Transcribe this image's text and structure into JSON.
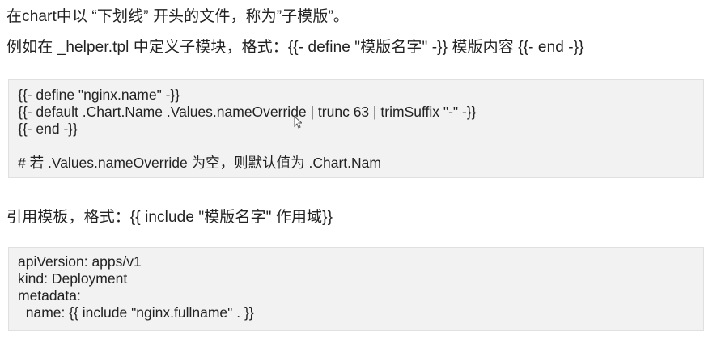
{
  "text": {
    "line1": "在chart中以 “下划线” 开头的文件，称为”子模版”。",
    "line2": "例如在 _helper.tpl 中定义子模块，格式：{{- define \"模版名字\" -}} 模版内容 {{- end -}}",
    "line3": "引用模板，格式：{{ include \"模版名字\" 作用域}}"
  },
  "code_block_1": {
    "lines": [
      "{{- define \"nginx.name\" -}}",
      "{{- default .Chart.Name .Values.nameOverride | trunc 63 | trimSuffix \"-\" -}}",
      "{{- end -}}",
      "",
      "# 若 .Values.nameOverride 为空，则默认值为 .Chart.Nam"
    ]
  },
  "code_block_2": {
    "lines": [
      "apiVersion: apps/v1",
      "kind: Deployment",
      "metadata:",
      "  name: {{ include \"nginx.fullname\" . }}"
    ]
  },
  "colors": {
    "text": "#222222",
    "code_background": "#f2f2f2",
    "code_border": "#e0e0e0"
  },
  "icons": {
    "cursor": "mouse-pointer-icon"
  }
}
